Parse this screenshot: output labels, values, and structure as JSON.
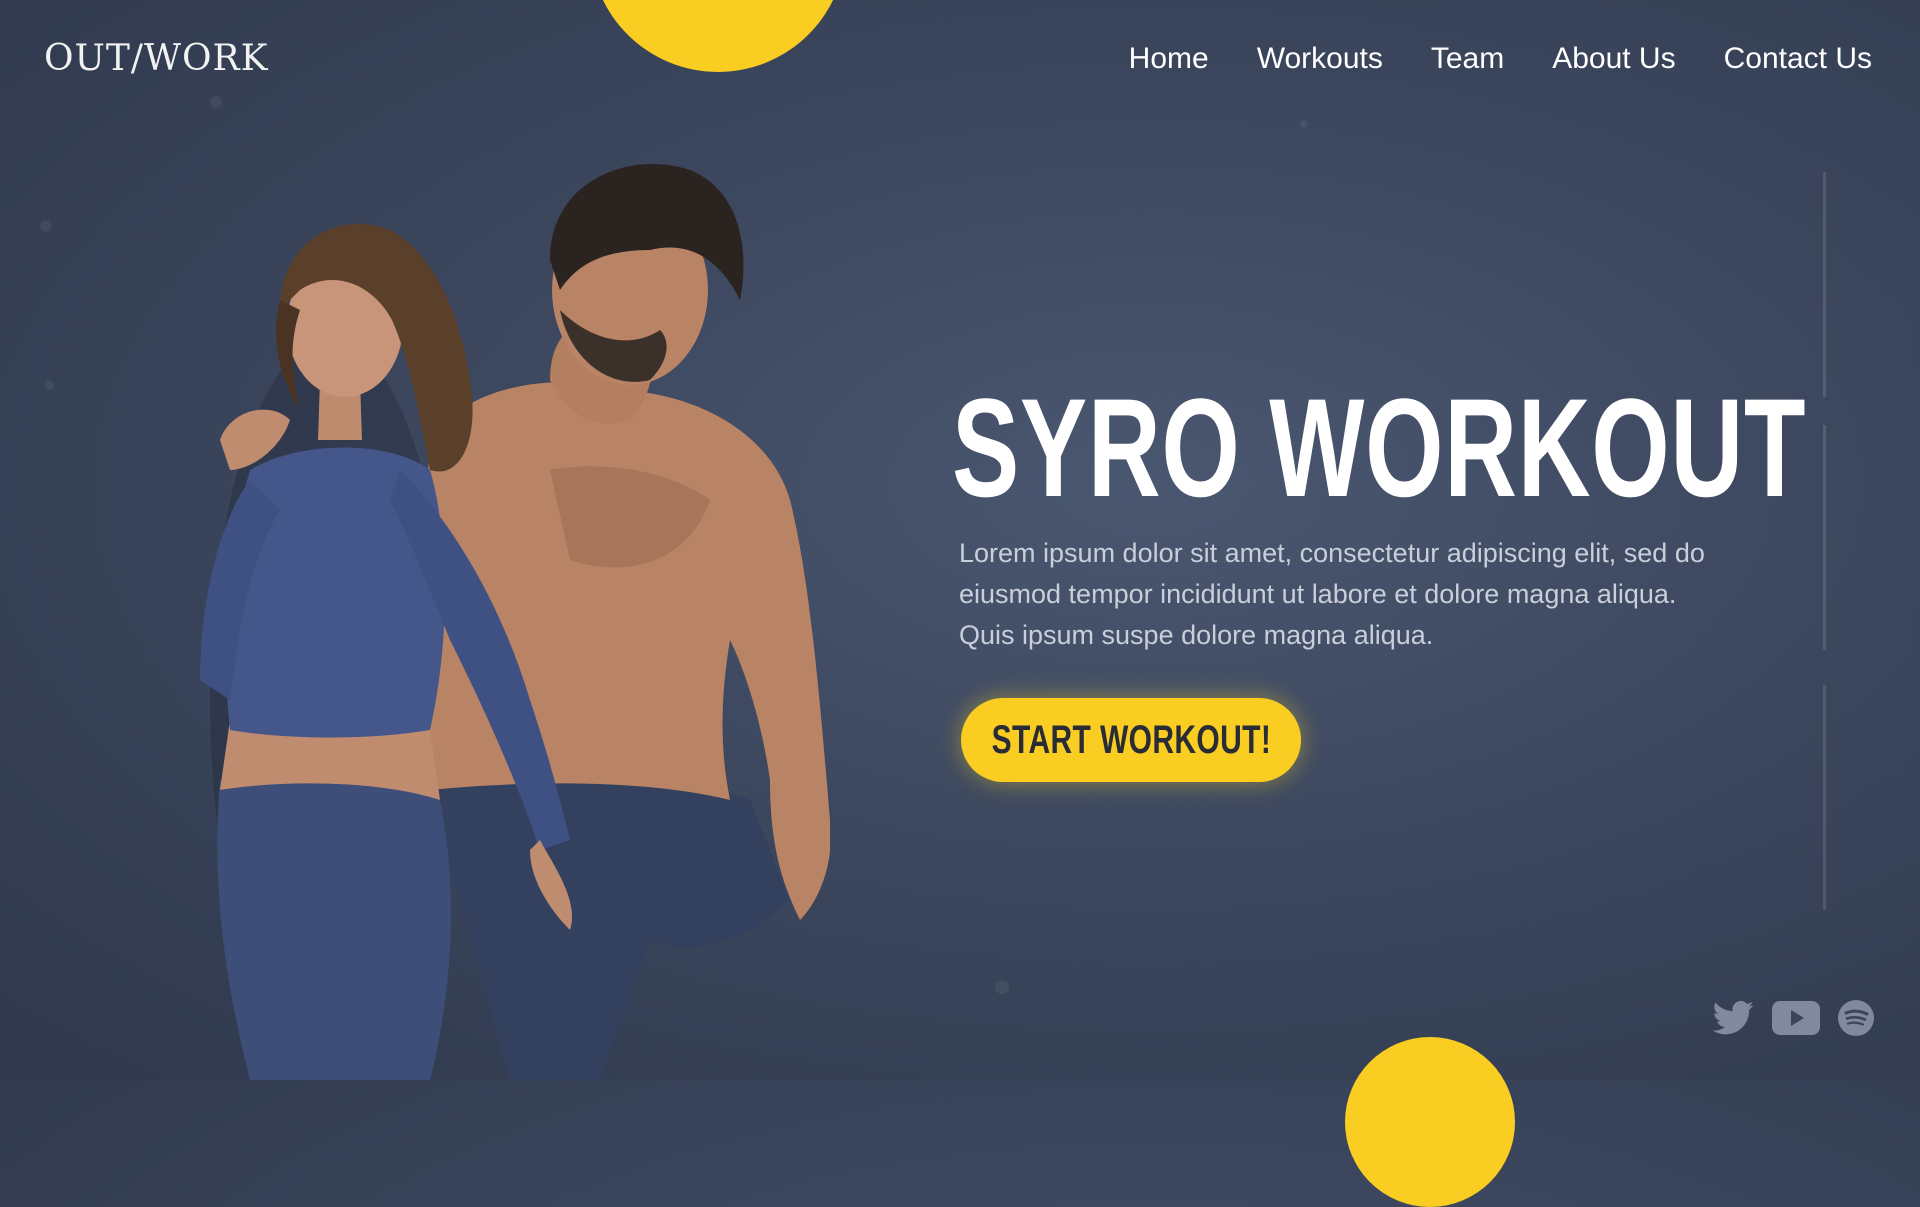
{
  "brand": {
    "logo_text": "OUT/WORK"
  },
  "nav": {
    "items": [
      {
        "label": "Home"
      },
      {
        "label": "Workouts"
      },
      {
        "label": "Team"
      },
      {
        "label": "About Us"
      },
      {
        "label": "Contact Us"
      }
    ]
  },
  "hero": {
    "title": "SYRO WORKOUT",
    "description": "Lorem ipsum dolor sit amet, consectetur adipiscing elit, sed do eiusmod tempor incididunt ut labore et dolore magna aliqua. Quis ipsum suspe dolore magna aliqua.",
    "cta_label": "START WORKOUT!",
    "image_subject": "fitness-couple-photo"
  },
  "socials": [
    {
      "icon": "twitter-icon"
    },
    {
      "icon": "youtube-icon"
    },
    {
      "icon": "spotify-icon"
    }
  ],
  "colors": {
    "background": "#3c475e",
    "accent": "#f9cd22",
    "text": "#ffffff",
    "muted_text": "#c9cfda",
    "apparel_blue": "#3d4e78"
  }
}
